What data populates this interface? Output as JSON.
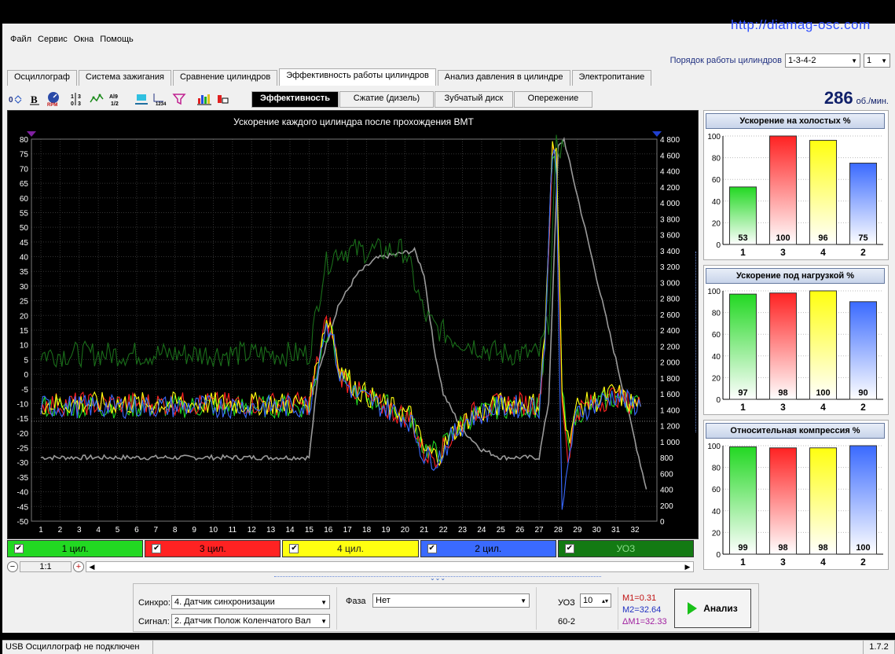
{
  "url": "http://diamag-osc.com",
  "menu": [
    "Файл",
    "Сервис",
    "Окна",
    "Помощь"
  ],
  "order": {
    "label": "Порядок работы цилиндров",
    "value": "1-3-4-2",
    "spin": "1"
  },
  "tabs": [
    "Осциллограф",
    "Система зажигания",
    "Сравнение цилиндров",
    "Эффективность работы цилиндров",
    "Анализ давления в цилиндре",
    "Электропитание"
  ],
  "active_tab": 3,
  "subtabs": [
    "Эффективность",
    "Сжатие (дизель)",
    "Зубчатый диск",
    "Опережение"
  ],
  "rpm": {
    "value": "286",
    "unit": "об./мин."
  },
  "colors": {
    "c1": "#22d822",
    "c3": "#ff2222",
    "c4": "#ffff10",
    "c2": "#3a6aff",
    "uoz": "#1a6e1a",
    "gray": "#9a9a9a"
  },
  "legend": [
    {
      "label": "1 цил.",
      "color": "#22d822"
    },
    {
      "label": "3 цил.",
      "color": "#ff2222"
    },
    {
      "label": "4 цил.",
      "color": "#ffff10"
    },
    {
      "label": "2 цил.",
      "color": "#3a6aff"
    },
    {
      "label": "УОЗ",
      "color": "#137a13"
    }
  ],
  "scale": "1:1",
  "controls": {
    "sync_label": "Синхро:",
    "sync_value": "4.  Датчик синхронизации",
    "signal_label": "Сигнал:",
    "signal_value": "2.  Датчик Полож Коленчатого Вал",
    "phase_label": "Фаза",
    "phase_value": "Нет",
    "uoz_label": "УОЗ",
    "uoz_value": "10",
    "teeth": "60-2",
    "m1": "M1=0.31",
    "m2": "M2=32.64",
    "dm": "ΔM1=32.33",
    "analyze": "Анализ"
  },
  "status": {
    "left": "USB Осциллограф не подключен",
    "version": "1.7.2"
  },
  "chart_data": [
    {
      "type": "line",
      "title": "Ускорение каждого цилиндра после прохождения ВМТ",
      "x_ticks": [
        1,
        2,
        3,
        4,
        5,
        6,
        7,
        8,
        9,
        10,
        11,
        12,
        13,
        14,
        15,
        16,
        17,
        18,
        19,
        20,
        21,
        22,
        23,
        24,
        25,
        26,
        27,
        28,
        29,
        30,
        31,
        32
      ],
      "ylim": [
        -50,
        80
      ],
      "y2lim": [
        0,
        4800
      ],
      "y_ticks": [
        80,
        75,
        70,
        65,
        60,
        55,
        50,
        45,
        40,
        35,
        30,
        25,
        20,
        15,
        10,
        5,
        0,
        -5,
        -10,
        -15,
        -20,
        -25,
        -30,
        -35,
        -40,
        -45,
        -50
      ],
      "y2_ticks": [
        "4 800",
        "4 600",
        "4 400",
        "4 200",
        "4 000",
        "3 800",
        "3 600",
        "3 400",
        "3 200",
        "3 000",
        "2 800",
        "2 600",
        "2 400",
        "2 200",
        "2 000",
        "1 800",
        "1 600",
        "1 400",
        "1 200",
        "1 000",
        "800",
        "600",
        "400",
        "200",
        "0"
      ],
      "series": [
        {
          "name": "1 цил.",
          "color": "#22d822",
          "values": [
            [
              1,
              -11
            ],
            [
              15,
              -11
            ],
            [
              15.8,
              14
            ],
            [
              16.1,
              16
            ],
            [
              16.6,
              -1
            ],
            [
              17.5,
              -7
            ],
            [
              18.5,
              -9
            ],
            [
              19.5,
              -12
            ],
            [
              20.3,
              -15
            ],
            [
              21,
              -25
            ],
            [
              21.7,
              -27
            ],
            [
              22.5,
              -20
            ],
            [
              23.3,
              -15
            ],
            [
              25,
              -11
            ],
            [
              27,
              -11
            ],
            [
              27.3,
              10
            ],
            [
              27.7,
              73
            ],
            [
              27.9,
              70
            ],
            [
              28.2,
              -5
            ],
            [
              28.5,
              -25
            ],
            [
              29,
              -13
            ],
            [
              30,
              -10
            ],
            [
              31,
              -8
            ],
            [
              31.5,
              -9
            ],
            [
              32.3,
              -11
            ]
          ]
        },
        {
          "name": "3 цил.",
          "color": "#ff2222",
          "values": [
            [
              1,
              -10
            ],
            [
              15,
              -10
            ],
            [
              15.8,
              16
            ],
            [
              16.1,
              17
            ],
            [
              16.6,
              0
            ],
            [
              17.5,
              -6
            ],
            [
              18.5,
              -10
            ],
            [
              19.5,
              -13
            ],
            [
              20.3,
              -15
            ],
            [
              21,
              -27
            ],
            [
              21.7,
              -28
            ],
            [
              22.5,
              -21
            ],
            [
              23.3,
              -14
            ],
            [
              25,
              -10
            ],
            [
              27,
              -10
            ],
            [
              27.3,
              12
            ],
            [
              27.7,
              75
            ],
            [
              27.9,
              72
            ],
            [
              28.2,
              -8
            ],
            [
              28.5,
              -28
            ],
            [
              29,
              -12
            ],
            [
              30,
              -10
            ],
            [
              31,
              -7
            ],
            [
              31.5,
              -9
            ],
            [
              32.3,
              -11
            ]
          ]
        },
        {
          "name": "4 цил.",
          "color": "#ffff10",
          "values": [
            [
              1,
              -10
            ],
            [
              15,
              -10
            ],
            [
              15.8,
              17
            ],
            [
              16.1,
              18
            ],
            [
              16.6,
              2
            ],
            [
              17.5,
              -5
            ],
            [
              18.5,
              -9
            ],
            [
              19.5,
              -12
            ],
            [
              20.3,
              -14
            ],
            [
              21,
              -26
            ],
            [
              21.7,
              -28
            ],
            [
              22.5,
              -20
            ],
            [
              23.3,
              -15
            ],
            [
              25,
              -10
            ],
            [
              27,
              -10
            ],
            [
              27.3,
              14
            ],
            [
              27.7,
              77
            ],
            [
              27.9,
              74
            ],
            [
              28.2,
              -3
            ],
            [
              28.5,
              -22
            ],
            [
              29,
              -11
            ],
            [
              30,
              -9
            ],
            [
              31,
              -6
            ],
            [
              31.5,
              -9
            ],
            [
              32.3,
              -11
            ]
          ]
        },
        {
          "name": "2 цил.",
          "color": "#3a6aff",
          "values": [
            [
              1,
              -11
            ],
            [
              15,
              -11
            ],
            [
              15.8,
              15
            ],
            [
              16.1,
              17
            ],
            [
              16.6,
              -1
            ],
            [
              17.5,
              -7
            ],
            [
              18.5,
              -10
            ],
            [
              19.5,
              -13
            ],
            [
              20.3,
              -16
            ],
            [
              21,
              -28
            ],
            [
              21.7,
              -29
            ],
            [
              22.5,
              -21
            ],
            [
              23.3,
              -15
            ],
            [
              25,
              -11
            ],
            [
              27,
              -11
            ],
            [
              27.3,
              11
            ],
            [
              27.7,
              78
            ],
            [
              27.9,
              71
            ],
            [
              28.2,
              -50
            ],
            [
              28.5,
              -30
            ],
            [
              29,
              -13
            ],
            [
              30,
              -10
            ],
            [
              31,
              -7
            ],
            [
              31.5,
              -9
            ],
            [
              32.3,
              -11
            ]
          ]
        },
        {
          "name": "УОЗ",
          "color": "#1a6e1a",
          "axis": "right",
          "values": [
            [
              1,
              2100
            ],
            [
              15,
              2100
            ],
            [
              15.8,
              3200
            ],
            [
              16.5,
              3400
            ],
            [
              20,
              3400
            ],
            [
              21,
              2600
            ],
            [
              21.5,
              2450
            ],
            [
              22.5,
              2300
            ],
            [
              25,
              2100
            ],
            [
              27,
              2100
            ],
            [
              27.5,
              2500
            ],
            [
              27.9,
              4700
            ],
            [
              28.3,
              4700
            ]
          ]
        },
        {
          "name": "RPM",
          "color": "#9a9a9a",
          "axis": "right",
          "values": [
            [
              1,
              800
            ],
            [
              15,
              800
            ],
            [
              15.5,
              1900
            ],
            [
              16.5,
              2700
            ],
            [
              17.5,
              3100
            ],
            [
              18.5,
              3300
            ],
            [
              19.5,
              3350
            ],
            [
              20.5,
              3400
            ],
            [
              21,
              3100
            ],
            [
              21.5,
              2200
            ],
            [
              22,
              1600
            ],
            [
              23,
              1150
            ],
            [
              24,
              900
            ],
            [
              25,
              800
            ],
            [
              27,
              800
            ],
            [
              27.5,
              1500
            ],
            [
              28,
              4700
            ],
            [
              28.3,
              4800
            ],
            [
              32.6,
              400
            ]
          ]
        }
      ]
    },
    {
      "type": "bar",
      "title": "Ускорение на холостых %",
      "categories": [
        "1",
        "3",
        "4",
        "2"
      ],
      "values": [
        53,
        100,
        96,
        75
      ],
      "colors": [
        "#22d822",
        "#ff2222",
        "#ffff10",
        "#3a6aff"
      ],
      "ylim": [
        0,
        100
      ],
      "y_ticks": [
        100,
        80,
        60,
        40,
        20,
        0
      ]
    },
    {
      "type": "bar",
      "title": "Ускорение под нагрузкой %",
      "categories": [
        "1",
        "3",
        "4",
        "2"
      ],
      "values": [
        97,
        98,
        100,
        90
      ],
      "colors": [
        "#22d822",
        "#ff2222",
        "#ffff10",
        "#3a6aff"
      ],
      "ylim": [
        0,
        100
      ],
      "y_ticks": [
        100,
        80,
        60,
        40,
        20,
        0
      ]
    },
    {
      "type": "bar",
      "title": "Относительная компрессия %",
      "categories": [
        "1",
        "3",
        "4",
        "2"
      ],
      "values": [
        99,
        98,
        98,
        100
      ],
      "colors": [
        "#22d822",
        "#ff2222",
        "#ffff10",
        "#3a6aff"
      ],
      "ylim": [
        0,
        100
      ],
      "y_ticks": [
        100,
        80,
        60,
        40,
        20,
        0
      ]
    }
  ]
}
